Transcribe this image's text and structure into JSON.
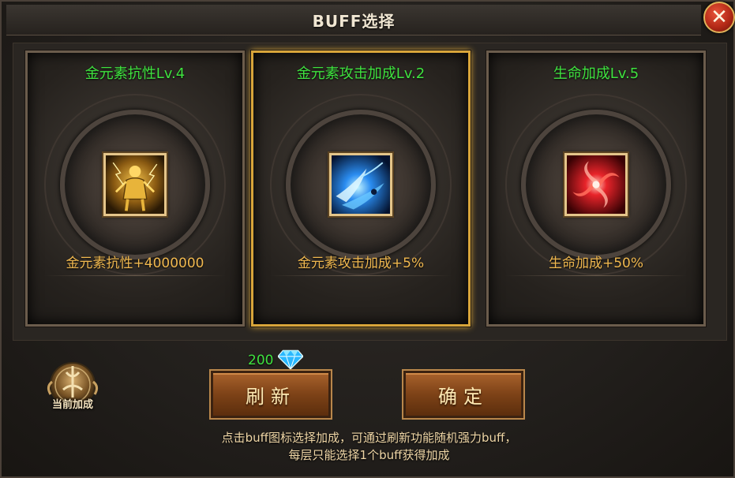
{
  "dialog": {
    "title": "BUFF选择",
    "close_icon": "close-icon"
  },
  "cards": [
    {
      "name": "金元素抗性Lv.4",
      "effect": "金元素抗性+4000000",
      "icon": "golden-statue-icon",
      "selected": false
    },
    {
      "name": "金元素攻击加成Lv.2",
      "effect": "金元素攻击加成+5%",
      "icon": "blue-slash-icon",
      "selected": true
    },
    {
      "name": "生命加成Lv.5",
      "effect": "生命加成+50%",
      "icon": "red-vortex-icon",
      "selected": false
    }
  ],
  "refresh_cost": {
    "value": "200",
    "icon": "diamond-icon"
  },
  "buttons": {
    "refresh": "刷新",
    "confirm": "确定"
  },
  "current_buff": {
    "label": "当前加成",
    "icon": "current-buff-emblem-icon"
  },
  "hint": {
    "line1": "点击buff图标选择加成，可通过刷新功能随机强力buff，",
    "line2": "每层只能选择1个buff获得加成"
  },
  "colors": {
    "name_green": "#3fe23f",
    "effect_gold": "#f0b84f",
    "selected_border": "#d8a53a",
    "button_brown": "#7d4217"
  }
}
